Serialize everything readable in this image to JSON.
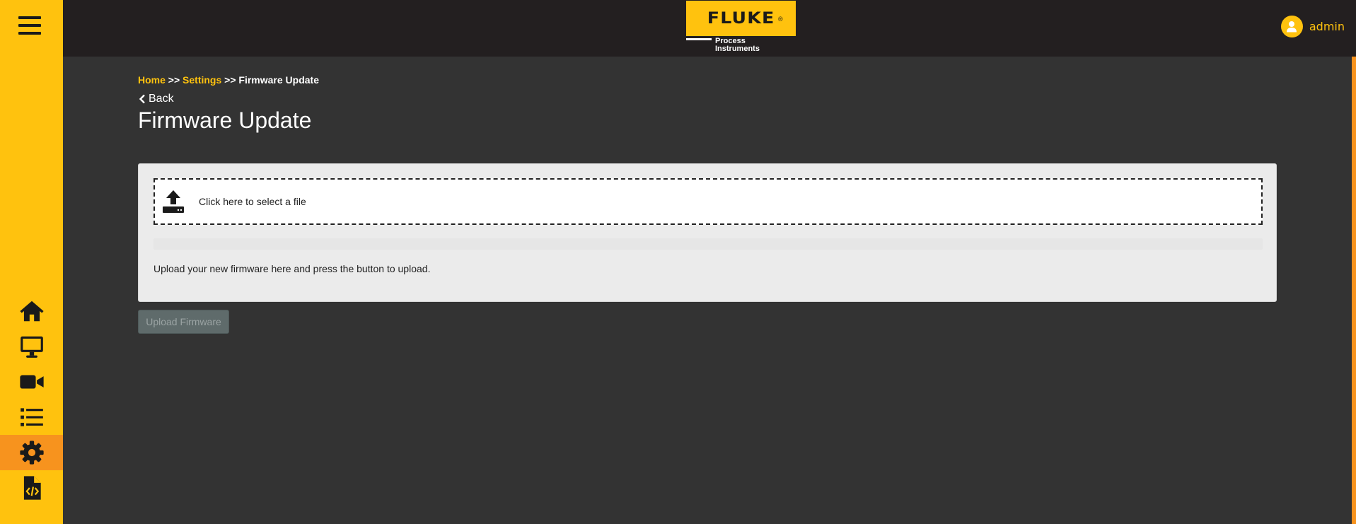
{
  "header": {
    "logo": {
      "brand": "FLUKE",
      "registered_mark": "®",
      "sub_line1": "Process",
      "sub_line2": "Instruments"
    },
    "user": {
      "name": "admin",
      "icon": "user-icon"
    }
  },
  "sidebar": {
    "menu_icon": "hamburger-menu-icon",
    "items": [
      {
        "id": "home",
        "icon": "home-icon",
        "active": false
      },
      {
        "id": "monitor",
        "icon": "monitor-icon",
        "active": false
      },
      {
        "id": "video",
        "icon": "video-camera-icon",
        "active": false
      },
      {
        "id": "list",
        "icon": "list-icon",
        "active": false
      },
      {
        "id": "settings",
        "icon": "gear-icon",
        "active": true
      },
      {
        "id": "code-file",
        "icon": "code-file-icon",
        "active": false
      }
    ]
  },
  "breadcrumb": {
    "home": "Home",
    "separator": ">>",
    "settings": "Settings",
    "current": "Firmware Update"
  },
  "back_label": "Back",
  "page_title": "Firmware Update",
  "upload_card": {
    "dropzone_text": "Click here to select a file",
    "help_text": "Upload your new firmware here and press the button to upload."
  },
  "upload_button": {
    "label": "Upload Firmware",
    "enabled": false
  },
  "colors": {
    "brand_yellow": "#FFC20E",
    "active_orange": "#F7931E",
    "topbar": "#231f20",
    "background": "#333333"
  }
}
